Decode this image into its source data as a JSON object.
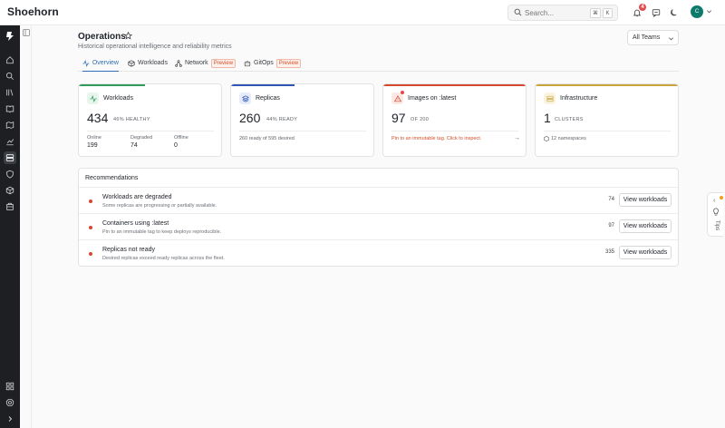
{
  "app": {
    "brand": "Shoehorn"
  },
  "topbar": {
    "search_placeholder": "Search...",
    "kbd_modifier": "⌘",
    "kbd_key": "K",
    "notification_count": "4",
    "avatar_initial": "C"
  },
  "header": {
    "title": "Operations",
    "subtitle": "Historical operational intelligence and reliability metrics",
    "team_select": "All Teams"
  },
  "tabs": [
    {
      "label": "Overview",
      "active": true,
      "icon": "activity-icon"
    },
    {
      "label": "Workloads",
      "active": false,
      "icon": "box-icon"
    },
    {
      "label": "Network",
      "active": false,
      "icon": "network-icon",
      "badge": "Preview"
    },
    {
      "label": "GitOps",
      "active": false,
      "icon": "robot-icon",
      "badge": "Preview"
    }
  ],
  "cards": {
    "workloads": {
      "title": "Workloads",
      "value": "434",
      "suffix": "46% HEALTHY",
      "accent": "#2e9c5a",
      "stats": [
        {
          "label": "Online",
          "value": "199"
        },
        {
          "label": "Degraded",
          "value": "74"
        },
        {
          "label": "Offline",
          "value": "0"
        }
      ]
    },
    "replicas": {
      "title": "Replicas",
      "value": "260",
      "suffix": "44% READY",
      "accent": "#2f55b5",
      "note": "260 ready of 595 desired"
    },
    "images": {
      "title": "Images on :latest",
      "value": "97",
      "suffix": "OF 200",
      "accent": "#d6482f",
      "note": "Pin to an immutable tag. Click to inspect.",
      "arrow": "→"
    },
    "infrastructure": {
      "title": "Infrastructure",
      "value": "1",
      "suffix": "CLUSTERS",
      "accent": "#c9a43a",
      "note": "12 namespaces"
    }
  },
  "recommendations": {
    "heading": "Recommendations",
    "items": [
      {
        "title": "Workloads are degraded",
        "desc": "Some replicas are progressing or partially available.",
        "count": "74",
        "action": "View workloads"
      },
      {
        "title": "Containers using :latest",
        "desc": "Pin to an immutable tag to keep deploys reproducible.",
        "count": "97",
        "action": "View workloads"
      },
      {
        "title": "Replicas not ready",
        "desc": "Desired replicas exceed ready replicas across the fleet.",
        "count": "335",
        "action": "View workloads"
      }
    ]
  },
  "tips": {
    "label": "Tips"
  },
  "colors": {
    "accent": "#2f6fb5",
    "danger": "#d6482f",
    "avatar": "#0e7a6c"
  }
}
